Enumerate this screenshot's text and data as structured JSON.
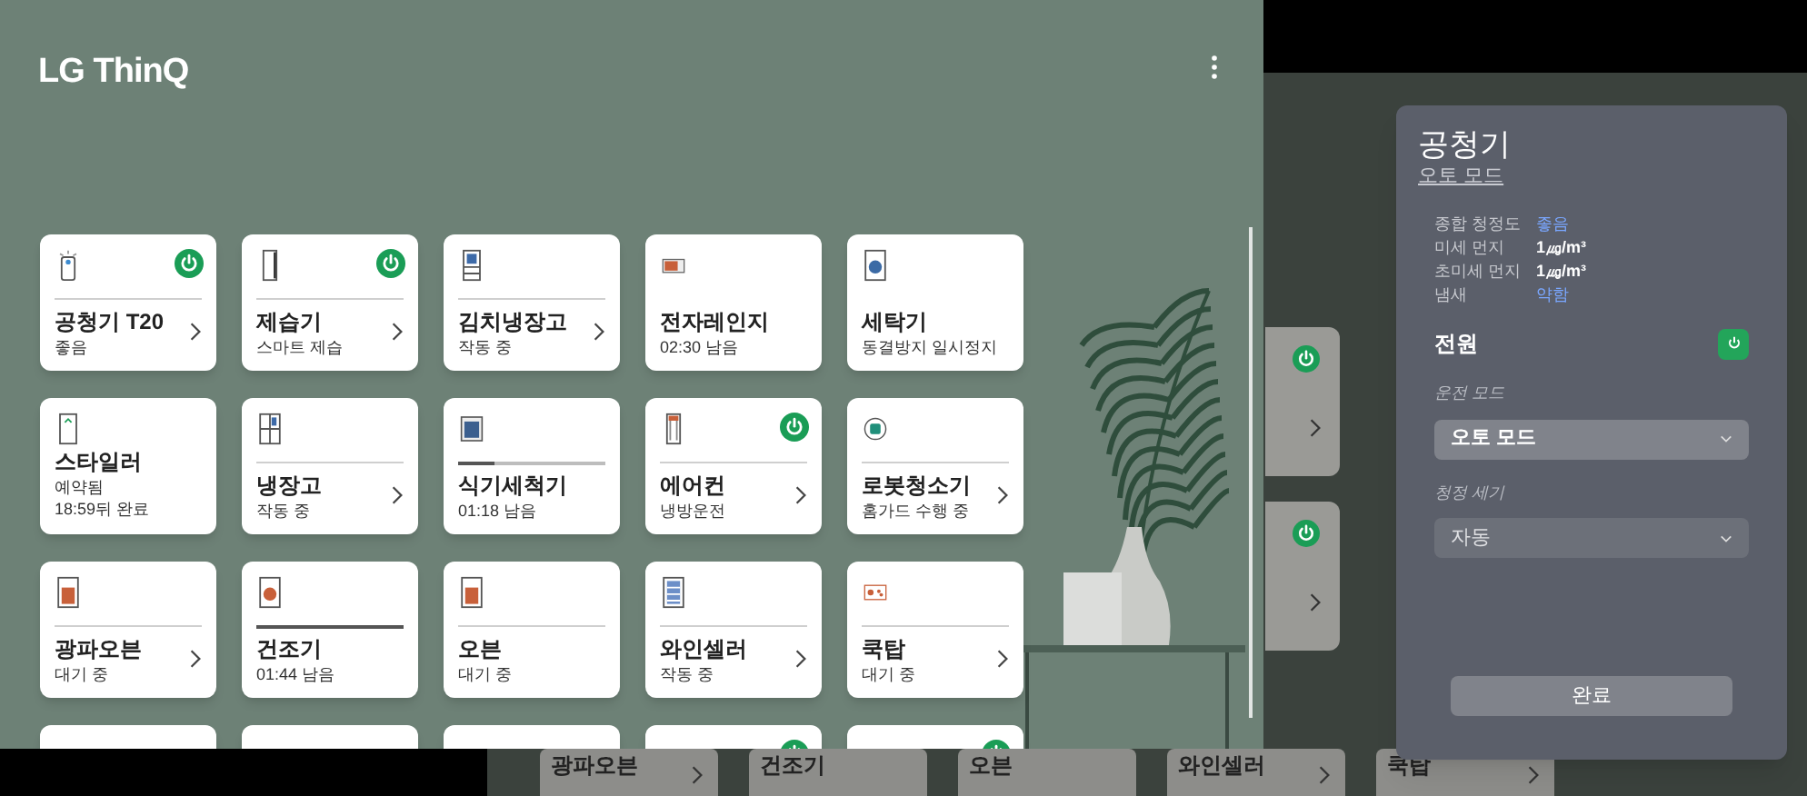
{
  "main_screen": {
    "logo": "LG ThinQ",
    "devices": [
      {
        "name": "공청기 T20",
        "status": [
          "좋음"
        ],
        "power": true,
        "kind": "divided",
        "chevron": true
      },
      {
        "name": "제습기",
        "status": [
          "스마트 제습"
        ],
        "power": true,
        "kind": "divided",
        "chevron": true
      },
      {
        "name": "김치냉장고",
        "status": [
          "작동 중"
        ],
        "power": false,
        "kind": "divided",
        "chevron": true
      },
      {
        "name": "전자레인지",
        "status": [
          "02:30 남음"
        ],
        "power": false,
        "kind": "plain",
        "chevron": false
      },
      {
        "name": "세탁기",
        "status": [
          "동결방지 일시정지"
        ],
        "power": false,
        "kind": "plain",
        "chevron": false
      },
      {
        "name": "스타일러",
        "status": [
          "예약됨",
          "18:59뒤 완료"
        ],
        "power": false,
        "kind": "plain",
        "chevron": false
      },
      {
        "name": "냉장고",
        "status": [
          "작동 중"
        ],
        "power": false,
        "kind": "divided",
        "chevron": true
      },
      {
        "name": "식기세척기",
        "status": [
          "01:18 남음"
        ],
        "power": false,
        "kind": "progress",
        "level": 0.25,
        "chevron": false
      },
      {
        "name": "에어컨",
        "status": [
          "냉방운전"
        ],
        "power": true,
        "kind": "divided",
        "chevron": true
      },
      {
        "name": "로봇청소기",
        "status": [
          "홈가드 수행 중"
        ],
        "power": false,
        "kind": "divided",
        "chevron": true
      },
      {
        "name": "광파오븐",
        "status": [
          "대기 중"
        ],
        "power": false,
        "kind": "divided",
        "chevron": true
      },
      {
        "name": "건조기",
        "status": [
          "01:44 남음"
        ],
        "power": false,
        "kind": "progress",
        "level": 1,
        "chevron": false
      },
      {
        "name": "오븐",
        "status": [
          "대기 중"
        ],
        "power": false,
        "kind": "divided",
        "chevron": false
      },
      {
        "name": "와인셀러",
        "status": [
          "작동 중"
        ],
        "power": false,
        "kind": "divided",
        "chevron": true
      },
      {
        "name": "쿡탑",
        "status": [
          "대기 중"
        ],
        "power": false,
        "kind": "divided",
        "chevron": true
      }
    ],
    "partial_cards": [
      {
        "power": false
      },
      {
        "power": false
      },
      {
        "power": false
      },
      {
        "power": true
      },
      {
        "power": true
      }
    ]
  },
  "back_screen": {
    "side_cards": [
      {
        "power": true
      },
      {
        "power": true
      }
    ],
    "bottom_cards": [
      {
        "name": "광파오븐",
        "chevron": true
      },
      {
        "name": "건조기",
        "chevron": false
      },
      {
        "name": "오븐",
        "chevron": false
      },
      {
        "name": "와인셀러",
        "chevron": true
      },
      {
        "name": "쿡탑",
        "chevron": true
      }
    ],
    "dialog": {
      "title": "공청기",
      "subtitle": "오토 모드",
      "stats": [
        {
          "label": "종합 청정도",
          "value": "좋음",
          "highlight": true
        },
        {
          "label": "미세 먼지",
          "value": "1㎍/m³",
          "highlight": false
        },
        {
          "label": "초미세 먼지",
          "value": "1㎍/m³",
          "highlight": false
        },
        {
          "label": "냄새",
          "value": "약함",
          "highlight": true
        }
      ],
      "power": {
        "label": "전원",
        "on": true
      },
      "selects": [
        {
          "label": "운전 모드",
          "value": "오토 모드"
        },
        {
          "label": "청정 세기",
          "value": "자동"
        }
      ],
      "button": "완료"
    }
  }
}
